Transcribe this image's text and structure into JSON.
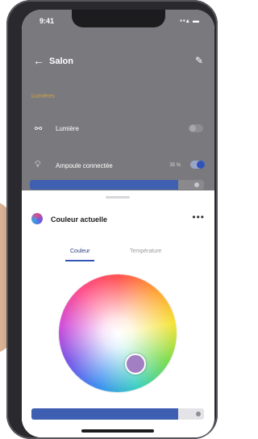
{
  "status_bar": {
    "time": "9:41",
    "icons": "▪▪▴ ▬"
  },
  "header": {
    "back_icon": "arrow-left-icon",
    "title": "Salon",
    "edit_icon": "pencil-icon"
  },
  "section": {
    "label": "Lumières"
  },
  "rows": [
    {
      "icon": "link-icon",
      "label": "Lumière",
      "toggle_on": false
    },
    {
      "icon": "bulb-icon",
      "label": "Ampoule connectée",
      "value_text": "35 %",
      "toggle_on": true
    }
  ],
  "brightness_background": {
    "fill_percent": 85
  },
  "sheet": {
    "title": "Couleur actuelle",
    "more_icon": "more-horizontal-icon",
    "tabs": [
      {
        "label": "Couleur",
        "active": true
      },
      {
        "label": "Température",
        "active": false
      }
    ],
    "selected_color": "#a27ec2",
    "brightness_fill_percent": 85
  },
  "colors": {
    "accent": "#3455b8",
    "section_label": "#d4a33c"
  }
}
